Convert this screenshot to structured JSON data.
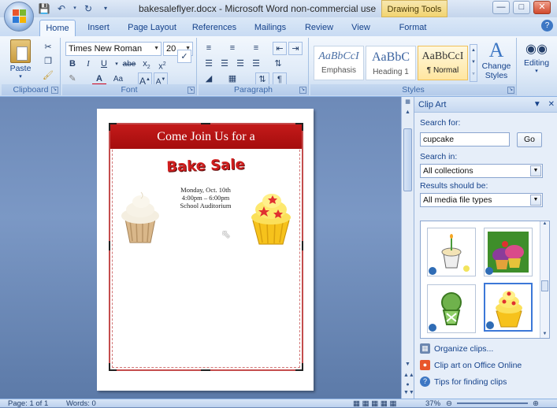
{
  "window": {
    "title": "bakesaleflyer.docx - Microsoft Word non-commercial use",
    "contextual_tab": "Drawing Tools"
  },
  "tabs": [
    "Home",
    "Insert",
    "Page Layout",
    "References",
    "Mailings",
    "Review",
    "View",
    "Format"
  ],
  "active_tab": "Home",
  "ribbon": {
    "clipboard": {
      "label": "Clipboard",
      "paste": "Paste"
    },
    "font": {
      "label": "Font",
      "font_name": "Times New Roman",
      "font_size": "20"
    },
    "paragraph": {
      "label": "Paragraph"
    },
    "styles": {
      "label": "Styles",
      "items": [
        {
          "sample": "AaBbCcI",
          "name": "Emphasis"
        },
        {
          "sample": "AaBbC",
          "name": "Heading 1"
        },
        {
          "sample": "AaBbCcI",
          "name": "¶ Normal"
        }
      ],
      "change_styles": "Change Styles",
      "editing": "Editing"
    }
  },
  "document": {
    "banner": "Come Join Us for a",
    "headline": "Bake Sale",
    "details": [
      "Monday, Oct. 10th",
      "4:00pm – 6:00pm",
      "School Auditorium"
    ]
  },
  "clipart_pane": {
    "title": "Clip Art",
    "search_for_label": "Search for:",
    "search_value": "cupcake",
    "go_label": "Go",
    "search_in_label": "Search in:",
    "search_in_value": "All collections",
    "results_label": "Results should be:",
    "results_value": "All media file types",
    "links": [
      "Organize clips...",
      "Clip art on Office Online",
      "Tips for finding clips"
    ]
  },
  "status_bar": {
    "page": "Page: 1 of 1",
    "words": "Words: 0",
    "zoom": "37%"
  },
  "colors": {
    "banner_red": "#b01414",
    "headline_red": "#d01e1e",
    "ribbon_blue": "#15428b"
  }
}
